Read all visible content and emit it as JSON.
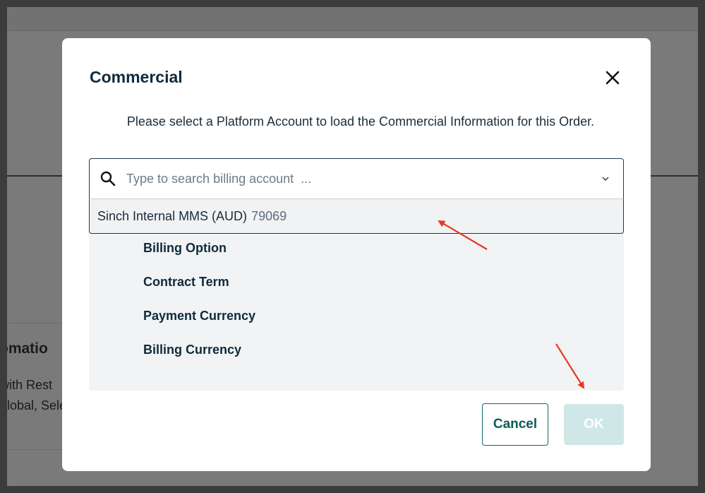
{
  "background": {
    "partial_heading": "tomatio",
    "partial_line1": "with Rest",
    "partial_line2": "Global, Sele",
    "partial_right_char": "S"
  },
  "modal": {
    "title": "Commercial",
    "description": "Please select a Platform Account to load the Commercial Information for this Order.",
    "search": {
      "placeholder": "Type to search billing account  ...",
      "value": ""
    },
    "dropdown_option": {
      "name": "Sinch Internal MMS (AUD)",
      "id": "79069"
    },
    "fields": [
      {
        "label": "Billing Option"
      },
      {
        "label": "Contract Term"
      },
      {
        "label": "Payment Currency"
      },
      {
        "label": "Billing Currency"
      }
    ],
    "buttons": {
      "cancel_label": "Cancel",
      "ok_label": "OK"
    }
  },
  "icons": {
    "search": "search-icon",
    "close": "close-icon",
    "chevron": "chevron-down-icon"
  },
  "colors": {
    "primary": "#0f6b66",
    "ok_disabled": "#cfe7e7",
    "annotation_arrow": "#e8391c"
  }
}
